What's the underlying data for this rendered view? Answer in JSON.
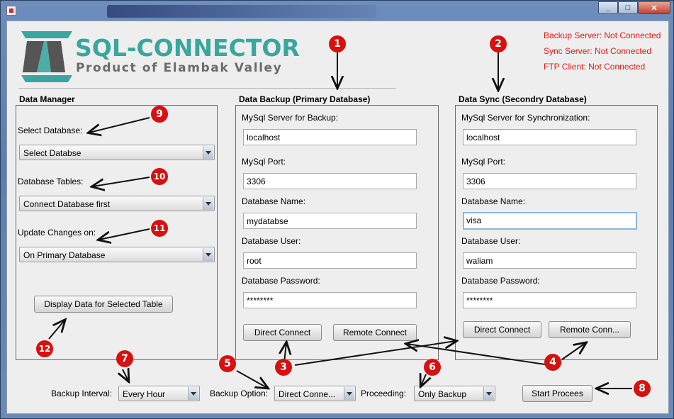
{
  "window": {
    "title_buttons": [
      "_",
      "□",
      "✕"
    ]
  },
  "logo": {
    "brand": "SQL-CONNECTOR",
    "tagline": "Product of Elambak Valley"
  },
  "status": {
    "backup_server": "Backup Server: Not Connected",
    "sync_server": "Sync Server: Not Connected",
    "ftp_client": "FTP Client: Not Connected"
  },
  "data_manager": {
    "title": "Data Manager",
    "select_db_label": "Select Database:",
    "select_db_value": "Select Databse",
    "tables_label": "Database Tables:",
    "tables_value": "Connect Database first",
    "update_label": "Update Changes on:",
    "update_value": "On Primary Database",
    "display_button": "Display Data for Selected Table"
  },
  "backup": {
    "title": "Data Backup (Primary Database)",
    "server_label": "MySql Server for Backup:",
    "server_value": "localhost",
    "port_label": "MySql Port:",
    "port_value": "3306",
    "dbname_label": "Database Name:",
    "dbname_value": "mydatabse",
    "user_label": "Database User:",
    "user_value": "root",
    "password_label": "Database Password:",
    "password_value": "********",
    "direct_button": "Direct Connect",
    "remote_button": "Remote Connect"
  },
  "sync": {
    "title": "Data Sync (Secondry Database)",
    "server_label": "MySql Server for Synchronization:",
    "server_value": "localhost",
    "port_label": "MySql Port:",
    "port_value": "3306",
    "dbname_label": "Database Name:",
    "dbname_value": "visa",
    "user_label": "Database User:",
    "user_value": "waliam",
    "password_label": "Database Password:",
    "password_value": "********",
    "direct_button": "Direct Connect",
    "remote_button": "Remote Conn..."
  },
  "bottom": {
    "interval_label": "Backup Interval:",
    "interval_value": "Every Hour",
    "option_label": "Backup Option:",
    "option_value": "Direct Conne...",
    "proceeding_label": "Proceeding:",
    "proceeding_value": "Only Backup",
    "start_button": "Start Procees"
  },
  "annotations": [
    "1",
    "2",
    "3",
    "4",
    "5",
    "6",
    "7",
    "8",
    "9",
    "10",
    "11",
    "12"
  ],
  "colors": {
    "status_red": "#e01b1b",
    "badge_red": "#d71010",
    "brand_teal": "#3aa69e"
  }
}
